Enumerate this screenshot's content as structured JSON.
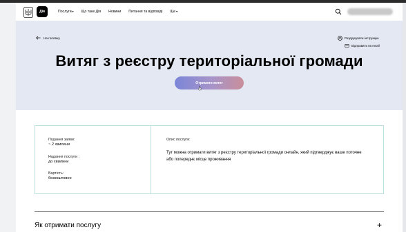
{
  "header": {
    "logo_text": "Дія",
    "nav": [
      {
        "label": "Послуги",
        "has_dropdown": true
      },
      {
        "label": "Що таке Дія",
        "has_dropdown": false
      },
      {
        "label": "Новини",
        "has_dropdown": false
      },
      {
        "label": "Питання та відповіді",
        "has_dropdown": false
      },
      {
        "label": "Ще",
        "has_dropdown": true
      }
    ],
    "dropdown_caret": "▾"
  },
  "hero": {
    "back_label": "На головну",
    "print_label": "Роздрукувати інструкцію",
    "email_label": "Відправити на email",
    "title": "Витяг з реєстру територіальної громади",
    "cta_label": "Отримати витяг"
  },
  "card": {
    "submit_label": "Подання заяви:",
    "submit_value": "~ 2 хвилини",
    "provide_label": "Надання послуги :",
    "provide_value": "до хвилини",
    "cost_label": "Вартість:",
    "cost_value": "безкоштовно",
    "desc_label": "Опис послуги:",
    "desc_text": "Тут можна отримати витяг з реєстру територіальної громади онлайн, який підтверджує ваше поточне або попереднє місце проживання"
  },
  "accordion": {
    "title": "Як отримати послугу",
    "expand_symbol": "+"
  },
  "colors": {
    "hero_bg": "#e3e8f3",
    "card_border": "#b9e0dc",
    "cta_gradient_start": "#7b86d8",
    "cta_gradient_end": "#c98e9a"
  }
}
